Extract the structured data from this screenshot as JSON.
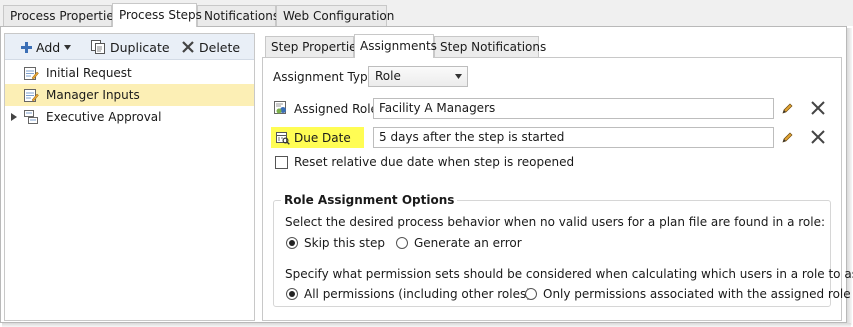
{
  "top_tabs": [
    "Process Properties",
    "Process Steps",
    "Notifications",
    "Web Configuration"
  ],
  "toolbar": {
    "add_label": "Add",
    "duplicate_label": "Duplicate",
    "delete_label": "Delete"
  },
  "tree": {
    "items": [
      {
        "label": "Initial Request"
      },
      {
        "label": "Manager Inputs"
      },
      {
        "label": "Executive Approval"
      }
    ]
  },
  "sub_tabs": [
    "Step Properties",
    "Assignments",
    "Step Notifications"
  ],
  "assignment_type": {
    "label": "Assignment Type",
    "value": "Role"
  },
  "assigned_role": {
    "label": "Assigned Role",
    "value": "Facility A Managers"
  },
  "due_date": {
    "label": "Due Date",
    "value": "5 days after the step is started",
    "highlight": "#fffd54"
  },
  "reset_checkbox": {
    "label": "Reset relative due date when step is reopened"
  },
  "role_options": {
    "title": "Role Assignment Options",
    "behavior_prompt": "Select the desired process behavior when no valid users for a plan file are found in a role:",
    "skip_label": "Skip this step",
    "error_label": "Generate an error",
    "permission_prompt": "Specify what permission sets should be considered when calculating which users in a role to assign",
    "all_perms_label": "All permissions (including other roles)",
    "only_perms_label": "Only permissions associated with the assigned role"
  },
  "colors": {
    "selected_row": "#fcefb5",
    "toolbar": "#e9eff7",
    "icon_blue": "#3b6fb6"
  }
}
